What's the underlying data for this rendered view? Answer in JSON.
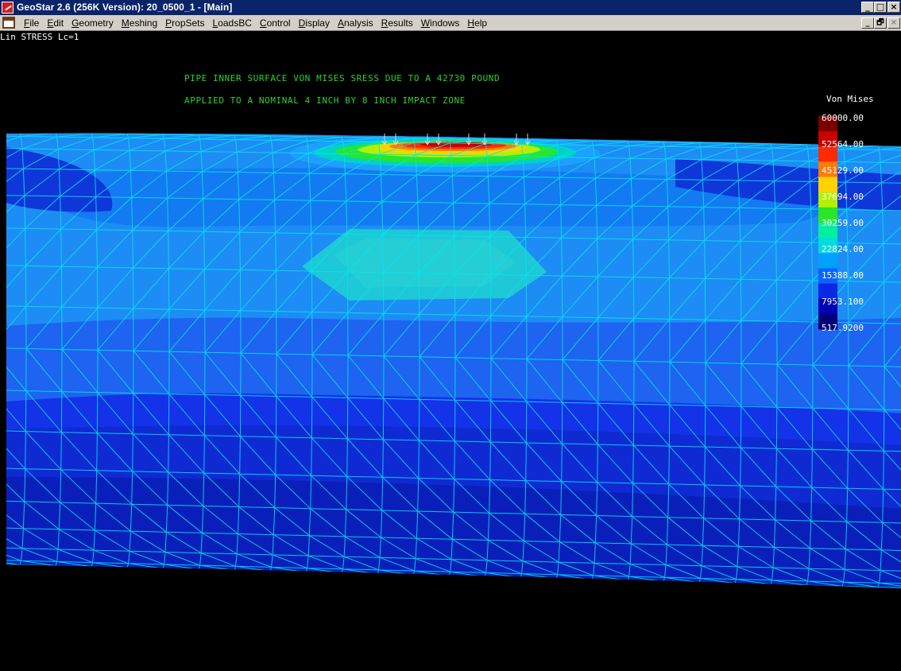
{
  "window": {
    "title": "GeoStar 2.6 (256K Version): 20_0500_1 - [Main]",
    "minimize_glyph": "_",
    "maximize_glyph": "□",
    "close_glyph": "×",
    "restore_glyph": "🗗"
  },
  "menu": {
    "items": [
      {
        "label": "File",
        "mnemonic": "F"
      },
      {
        "label": "Edit",
        "mnemonic": "E"
      },
      {
        "label": "Geometry",
        "mnemonic": "G"
      },
      {
        "label": "Meshing",
        "mnemonic": "M"
      },
      {
        "label": "PropSets",
        "mnemonic": "P"
      },
      {
        "label": "LoadsBC",
        "mnemonic": "L"
      },
      {
        "label": "Control",
        "mnemonic": "C"
      },
      {
        "label": "Display",
        "mnemonic": "D"
      },
      {
        "label": "Analysis",
        "mnemonic": "A"
      },
      {
        "label": "Results",
        "mnemonic": "R"
      },
      {
        "label": "Windows",
        "mnemonic": "W"
      },
      {
        "label": "Help",
        "mnemonic": "H"
      }
    ]
  },
  "plot": {
    "status_line": "Lin STRESS Lc=1",
    "annotation_1": "PIPE INNER SURFACE VON MISES SRESS DUE TO A 42730 POUND",
    "annotation_2": "APPLIED TO A NOMINAL 4 INCH BY 8 INCH IMPACT ZONE",
    "legend": {
      "title": "Von Mises",
      "labels": [
        "60000.00",
        "52564.00",
        "45129.00",
        "37694.00",
        "30259.00",
        "22824.00",
        "15388.00",
        "7953.100",
        "517.9200"
      ],
      "colors": [
        "#7a0000",
        "#c80000",
        "#ff2a00",
        "#ff7a00",
        "#ffd200",
        "#b4f000",
        "#28e628",
        "#00f0a0",
        "#00dcdc",
        "#00a0ff",
        "#0a64ff",
        "#0a28e6",
        "#0000b4",
        "#000078"
      ]
    }
  },
  "colors": {
    "titlebar": "#0a246a",
    "menubar": "#d4d0c8",
    "mesh": "#00e6f0",
    "annotation": "#2ed12e"
  }
}
